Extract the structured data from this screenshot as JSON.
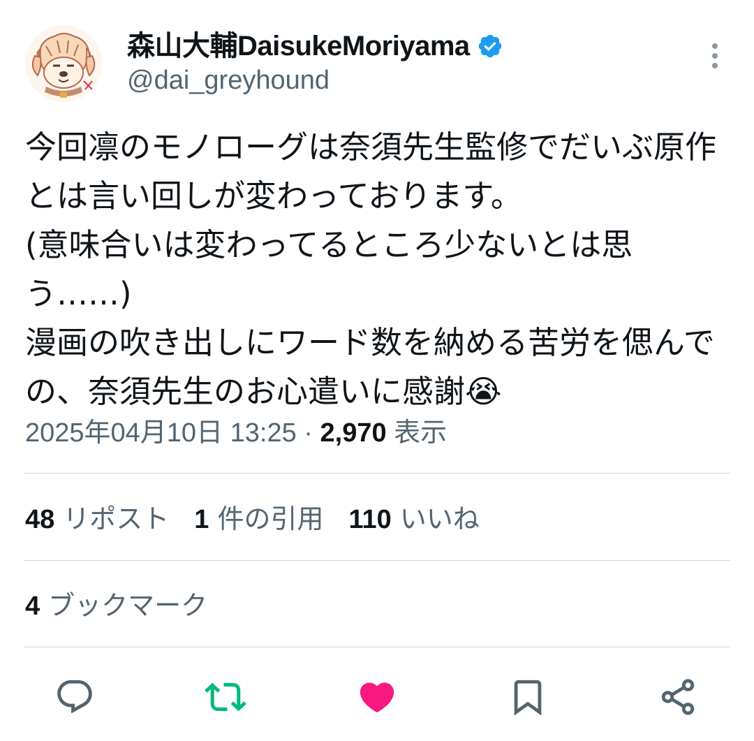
{
  "author": {
    "display_name": "森山大輔DaisukeMoriyama",
    "handle": "@dai_greyhound",
    "avatar_icon": "avatar-dog-illustration",
    "verified_color": "#1d9bf0"
  },
  "tweet": {
    "text": "今回凛のモノローグは奈須先生監修でだいぶ原作とは言い回しが変わっております。\n(意味合いは変わってるところ少ないとは思う……)\n漫画の吹き出しにワード数を納める苦労を偲んでの、奈須先生のお心遣いに感謝😭",
    "timestamp": "2025年04月10日 13:25",
    "separator": "·",
    "views_count": "2,970",
    "views_label": "表示"
  },
  "stats": {
    "reposts_count": "48",
    "reposts_label": "リポスト",
    "quotes_count": "1",
    "quotes_label": "件の引用",
    "likes_count": "110",
    "likes_label": "いいね",
    "bookmarks_count": "4",
    "bookmarks_label": "ブックマーク"
  },
  "actions": {
    "reply_icon": "reply-icon",
    "retweet_icon": "retweet-icon",
    "like_icon": "heart-icon",
    "bookmark_icon": "bookmark-icon",
    "share_icon": "share-icon",
    "retweet_color": "#00ba7c",
    "like_color": "#f91880",
    "icon_color": "#536471"
  }
}
